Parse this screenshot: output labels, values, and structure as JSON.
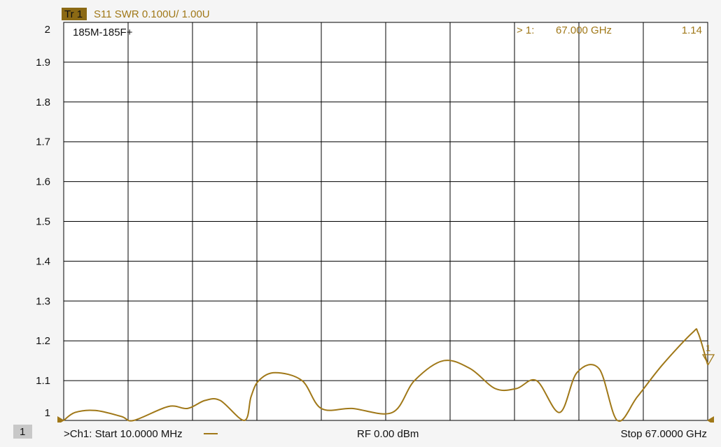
{
  "trace_header": {
    "tr_label": "Tr 1",
    "title": "S11 SWR 0.100U/  1.00U"
  },
  "annotation": "185M-185F+",
  "marker": {
    "label": "> 1:",
    "frequency": "67.000  GHz",
    "value": "1.14",
    "symbol_label": "1"
  },
  "status_bar": {
    "channel_box": "1",
    "start": ">Ch1:  Start  10.0000 MHz",
    "rf": "RF    0.00 dBm",
    "stop": "Stop  67.0000 GHz"
  },
  "colors": {
    "trace": "#A07818",
    "header_box": "#8B6914",
    "grid": "#000000",
    "background": "#ffffff",
    "channel_box": "#c8c8c8"
  },
  "chart_data": {
    "type": "line",
    "title": "S11 SWR 0.100U/  1.00U",
    "xlabel": "",
    "ylabel": "",
    "xlim": [
      0.01,
      67
    ],
    "ylim": [
      1.0,
      2.0
    ],
    "yticks": [
      "2",
      "1.9",
      "1.8",
      "1.7",
      "1.6",
      "1.5",
      "1.4",
      "1.3",
      "1.2",
      "1.1",
      "1"
    ],
    "grid": true,
    "series": [
      {
        "x": [
          0.01,
          1.2,
          3.3,
          6.0,
          7.3,
          10.9,
          12.9,
          14.7,
          16.3,
          18.8,
          19.5,
          20.3,
          22.0,
          24.8,
          26.8,
          30.0,
          34.2,
          36.5,
          39.5,
          42.3,
          44.9,
          47.1,
          49.2,
          51.6,
          53.4,
          55.7,
          57.6,
          59.7,
          62.3,
          65.4,
          66.0,
          67.0
        ],
        "y": [
          1.0,
          1.02,
          1.025,
          1.01,
          1.0,
          1.035,
          1.03,
          1.05,
          1.05,
          1.0,
          1.06,
          1.1,
          1.12,
          1.1,
          1.03,
          1.03,
          1.02,
          1.1,
          1.15,
          1.13,
          1.08,
          1.08,
          1.1,
          1.02,
          1.12,
          1.13,
          1.0,
          1.06,
          1.14,
          1.22,
          1.22,
          1.14
        ]
      }
    ]
  }
}
